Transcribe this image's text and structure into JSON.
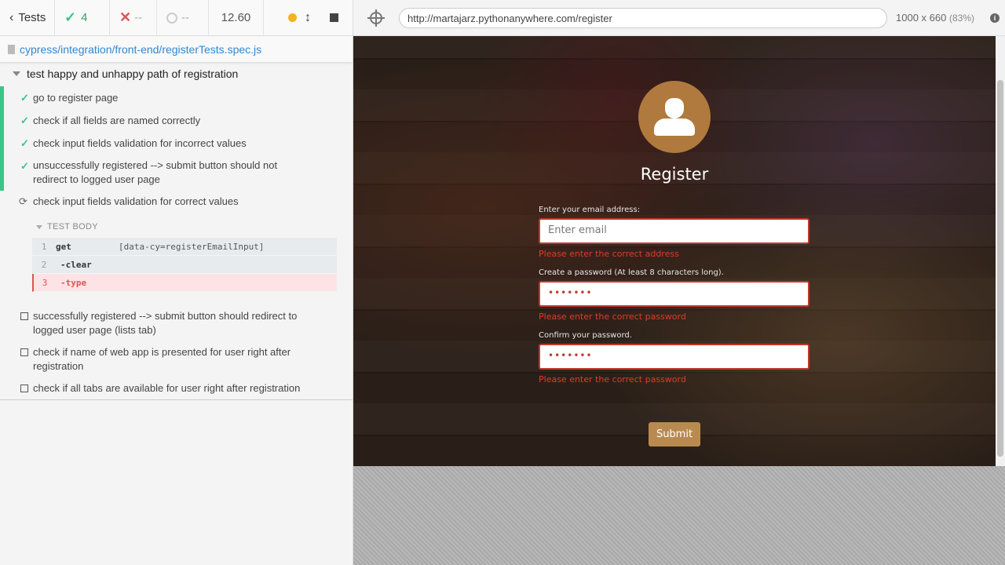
{
  "header": {
    "tests_label": "Tests",
    "passed_count": "4",
    "failed_count": "--",
    "pending_count": "--",
    "duration": "12.60"
  },
  "spec": {
    "path": "cypress/integration/front-end/registerTests.spec.js"
  },
  "suite": {
    "title": "test happy and unhappy path of registration",
    "tests": [
      {
        "state": "passed",
        "title": "go to register page"
      },
      {
        "state": "passed",
        "title": "check if all fields are named correctly"
      },
      {
        "state": "passed",
        "title": "check input fields validation for incorrect values"
      },
      {
        "state": "passed",
        "title": "unsuccessfully registered --> submit button should not redirect to logged user page"
      },
      {
        "state": "running",
        "title": "check input fields validation for correct values"
      },
      {
        "state": "pending",
        "title": "successfully registered --> submit button should redirect to logged user page (lists tab)"
      },
      {
        "state": "pending",
        "title": "check if name of web app is presented for user right after registration"
      },
      {
        "state": "pending",
        "title": "check if all tabs are available for user right after registration"
      }
    ]
  },
  "test_body": {
    "label": "TEST BODY",
    "commands": [
      {
        "num": "1",
        "name": "get",
        "message": "[data-cy=registerEmailInput]"
      },
      {
        "num": "2",
        "name": "-clear",
        "message": ""
      },
      {
        "num": "3",
        "name": "-type",
        "message": ""
      }
    ]
  },
  "aut": {
    "url": "http://martajarz.pythonanywhere.com/register",
    "viewport": "1000 x 660",
    "scale": "(83%)"
  },
  "form": {
    "title": "Register",
    "email_label": "Enter your email address:",
    "email_placeholder": "Enter email",
    "email_error": "Please enter the correct address",
    "password_label": "Create a password (At least 8 characters long).",
    "password_value": "•••••••",
    "password_error": "Please enter the correct password",
    "confirm_label": "Confirm your password.",
    "confirm_value": "•••••••",
    "confirm_error": "Please enter the correct password",
    "submit_label": "Submit"
  },
  "colors": {
    "passed": "#3ac586",
    "failed": "#e15353",
    "error_text": "#e03b2b",
    "submit_bg": "#b98a50"
  }
}
